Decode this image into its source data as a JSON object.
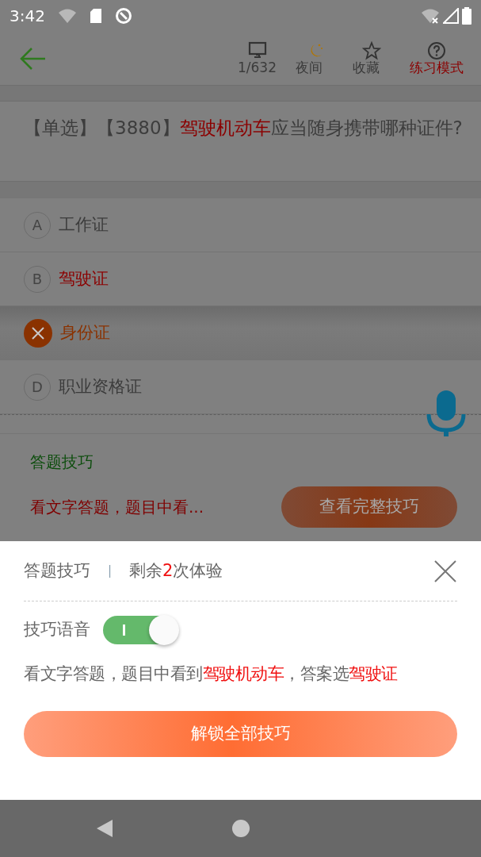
{
  "status_bar": {
    "time": "3:42"
  },
  "toolbar": {
    "items": [
      {
        "kind": "counter",
        "label": "1/632"
      },
      {
        "kind": "night",
        "label": "夜间"
      },
      {
        "kind": "favorite",
        "label": "收藏"
      },
      {
        "kind": "mode",
        "label": "练习模式"
      }
    ]
  },
  "question": {
    "segments": [
      {
        "text": "【单选】【3880】",
        "highlight": false
      },
      {
        "text": "驾驶机动车",
        "highlight": true
      },
      {
        "text": "应当随身携带哪种证件?",
        "highlight": false
      }
    ]
  },
  "options": [
    {
      "letter": "A",
      "text": "工作证",
      "kind": "normal"
    },
    {
      "letter": "B",
      "text": "驾驶证",
      "kind": "correct"
    },
    {
      "text": "身份证",
      "kind": "wrong"
    },
    {
      "letter": "D",
      "text": "职业资格证",
      "kind": "normal"
    }
  ],
  "tips": {
    "title": "答题技巧",
    "preview": "看文字答题，题目中看...",
    "button": "查看完整技巧"
  },
  "sheet": {
    "title": "答题技巧",
    "divider": "|",
    "remaining": [
      {
        "text": "剩余",
        "highlight": false
      },
      {
        "text": "2",
        "highlight": true
      },
      {
        "text": "次体验",
        "highlight": false
      }
    ],
    "voice": {
      "label": "技巧语音",
      "on": true
    },
    "tip": [
      {
        "text": "看文字答题，题目中看到",
        "highlight": false
      },
      {
        "text": "驾驶机动车",
        "highlight": true
      },
      {
        "text": "，答案选",
        "highlight": false
      },
      {
        "text": "驾驶证",
        "highlight": true
      }
    ],
    "button": "解锁全部技巧"
  }
}
